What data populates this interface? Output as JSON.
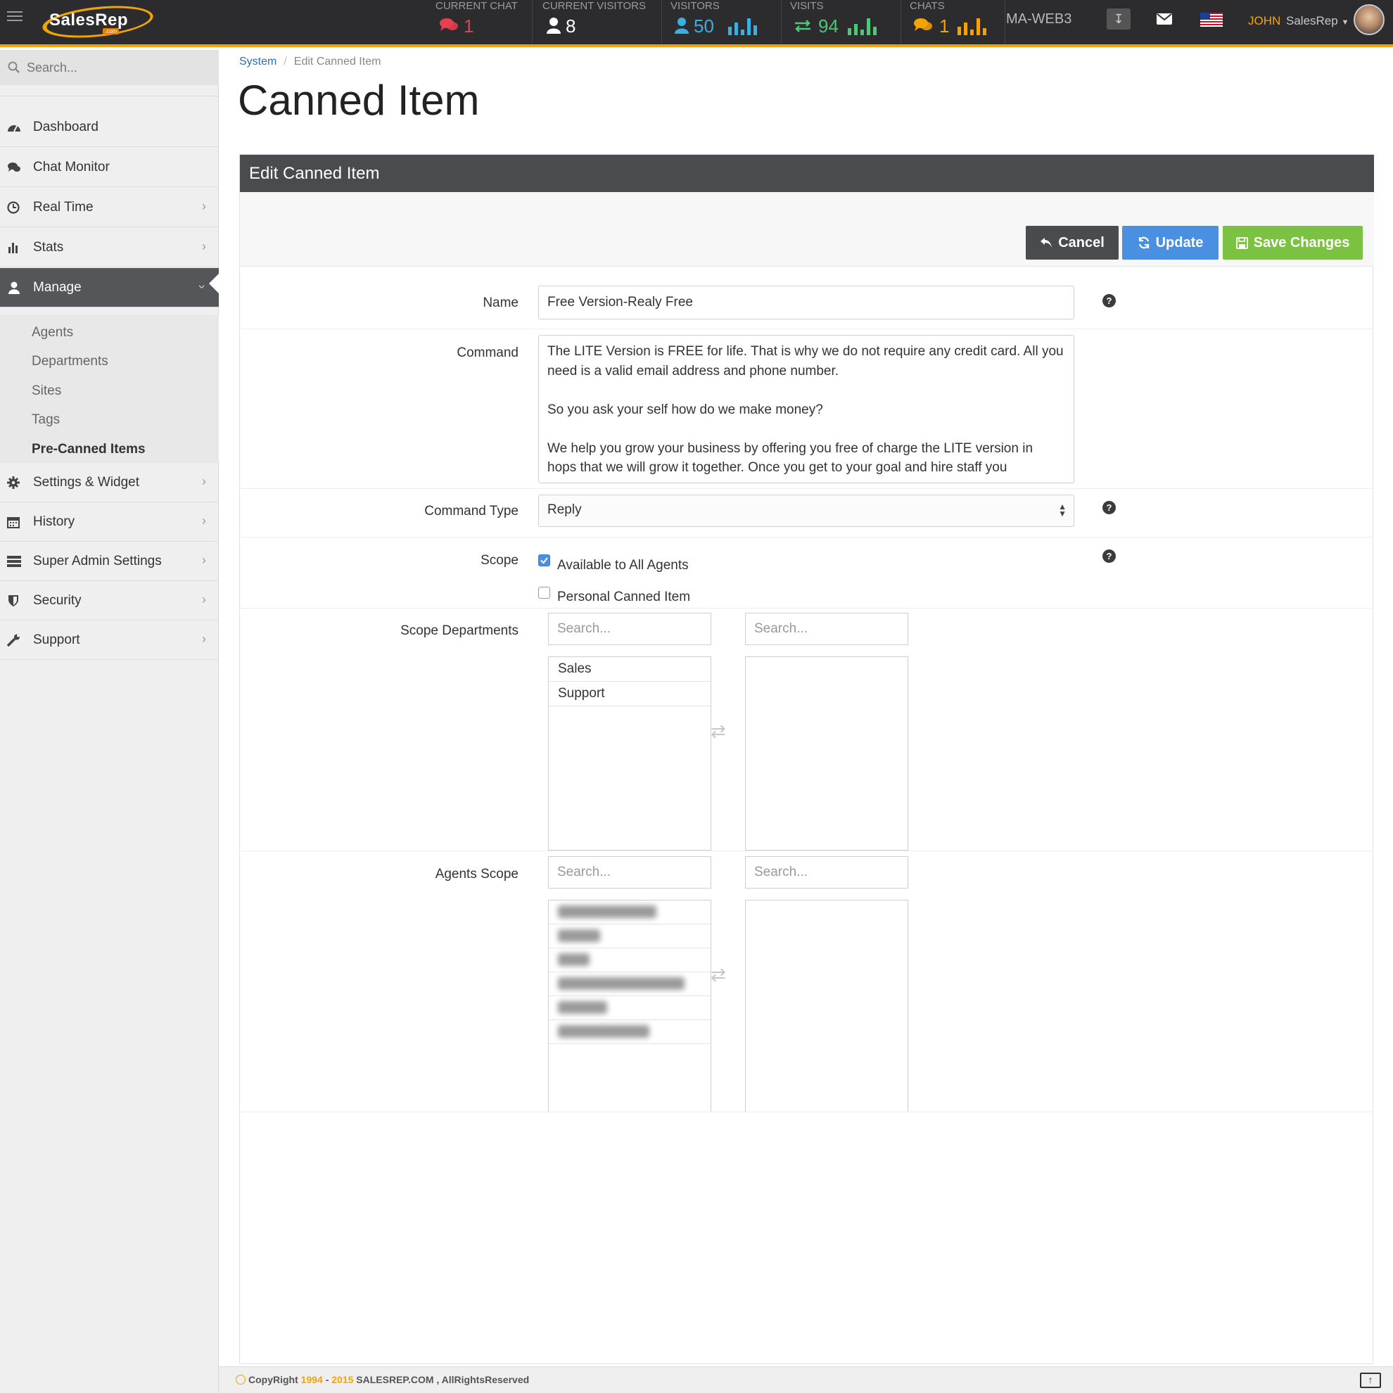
{
  "app": {
    "logo_text": "SalesRep",
    "logo_sub": ".com"
  },
  "topbar": {
    "stats": [
      {
        "label": "CURRENT CHAT",
        "value": "1",
        "icon": "chat-bubbles-icon",
        "color": "#e8404f"
      },
      {
        "label": "CURRENT VISITORS",
        "value": "8",
        "icon": "user-icon",
        "color": "#ffffff"
      },
      {
        "label": "VISITORS",
        "value": "50",
        "icon": "user-icon",
        "color": "#3ab0e2"
      },
      {
        "label": "VISITS",
        "value": "94",
        "icon": "swap-arrows-icon",
        "color": "#4fc774"
      },
      {
        "label": "CHATS",
        "value": "1",
        "icon": "chat-bubbles-icon",
        "color": "#f5a300"
      }
    ],
    "server": "MA-WEB3",
    "user_first": "JOHN",
    "user_last": "SalesRep"
  },
  "sidebar": {
    "search_placeholder": "Search...",
    "items": [
      {
        "label": "Dashboard",
        "icon": "dashboard-icon"
      },
      {
        "label": "Chat Monitor",
        "icon": "chat-icon"
      },
      {
        "label": "Real Time",
        "icon": "clock-icon"
      },
      {
        "label": "Stats",
        "icon": "bar-chart-icon"
      },
      {
        "label": "Manage",
        "icon": "user-icon"
      },
      {
        "label": "Settings & Widget",
        "icon": "gear-icon"
      },
      {
        "label": "History",
        "icon": "calendar-icon"
      },
      {
        "label": "Super Admin Settings",
        "icon": "server-icon"
      },
      {
        "label": "Security",
        "icon": "shield-icon"
      },
      {
        "label": "Support",
        "icon": "wrench-icon"
      }
    ],
    "manage_sub": [
      "Agents",
      "Departments",
      "Sites",
      "Tags",
      "Pre-Canned Items"
    ]
  },
  "breadcrumb": {
    "root": "System",
    "current": "Edit Canned Item"
  },
  "page_title": "Canned Item",
  "panel": {
    "title": "Edit Canned Item",
    "buttons": {
      "cancel": "Cancel",
      "update": "Update",
      "save": "Save Changes"
    }
  },
  "form": {
    "name_label": "Name",
    "name_value": "Free Version-Realy Free",
    "command_label": "Command",
    "command_value": "The LITE Version is FREE for life. That is why we do not require any credit card. All you need is a valid email address and phone number.\n\nSo you ask your self how do we make money?\n\nWe help you grow your business by offering you free of charge the LITE version in hops that we will grow it together. Once you get to your goal and hire staff you",
    "command_type_label": "Command Type",
    "command_type_value": "Reply",
    "scope_label": "Scope",
    "scope_options": [
      {
        "label": "Available to All Agents",
        "checked": true
      },
      {
        "label": "Personal Canned Item",
        "checked": false
      }
    ],
    "scope_departments_label": "Scope Departments",
    "agents_scope_label": "Agents Scope",
    "search_placeholder": "Search...",
    "departments_available": [
      "Sales",
      "Support"
    ]
  },
  "footer": {
    "prefix": "CopyRight ",
    "year_start": "1994",
    "dash": " - ",
    "year_end": "2015",
    "suffix": " SALESREP.COM , AllRightsReserved"
  }
}
